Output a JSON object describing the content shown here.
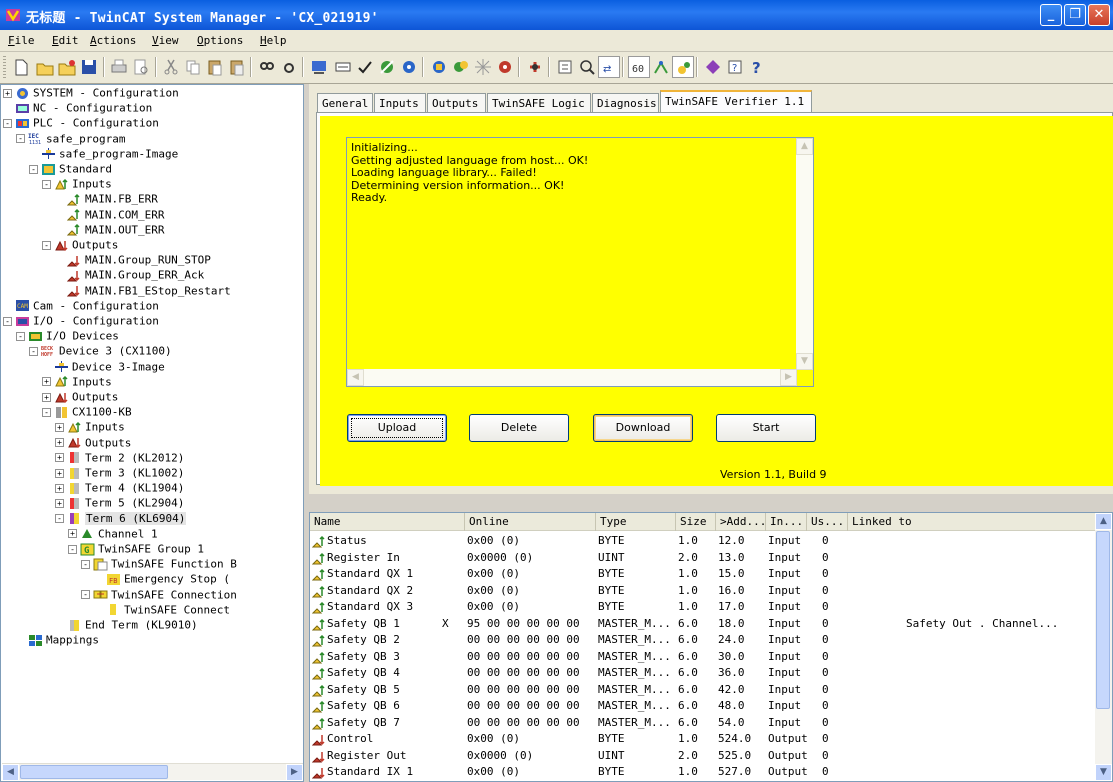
{
  "window": {
    "title": "无标题 - TwinCAT System Manager - 'CX_021919'"
  },
  "menu": [
    "File",
    "Edit",
    "Actions",
    "View",
    "Options",
    "Help"
  ],
  "tree": [
    {
      "label": "SYSTEM - Configuration",
      "icon": "system-icon",
      "exp": "+"
    },
    {
      "label": "NC - Configuration",
      "icon": "nc-icon",
      "exp": ""
    },
    {
      "label": "PLC - Configuration",
      "icon": "plc-icon",
      "exp": "-"
    },
    {
      "label": "safe_program",
      "icon": "iec-icon",
      "exp": "-"
    },
    {
      "label": "safe_program-Image",
      "icon": "image-icon",
      "exp": ""
    },
    {
      "label": "Standard",
      "icon": "task-icon",
      "exp": "-"
    },
    {
      "label": "Inputs",
      "icon": "inputs-icon",
      "exp": "-"
    },
    {
      "label": "MAIN.FB_ERR",
      "icon": "input-var-icon",
      "exp": ""
    },
    {
      "label": "MAIN.COM_ERR",
      "icon": "input-var-icon",
      "exp": ""
    },
    {
      "label": "MAIN.OUT_ERR",
      "icon": "input-var-icon",
      "exp": ""
    },
    {
      "label": "Outputs",
      "icon": "outputs-icon",
      "exp": "-"
    },
    {
      "label": "MAIN.Group_RUN_STOP",
      "icon": "output-var-icon",
      "exp": ""
    },
    {
      "label": "MAIN.Group_ERR_Ack",
      "icon": "output-var-icon",
      "exp": ""
    },
    {
      "label": "MAIN.FB1_EStop_Restart",
      "icon": "output-var-icon",
      "exp": ""
    },
    {
      "label": "Cam - Configuration",
      "icon": "cam-icon",
      "exp": ""
    },
    {
      "label": "I/O - Configuration",
      "icon": "io-icon",
      "exp": "-"
    },
    {
      "label": "I/O Devices",
      "icon": "io-devices-icon",
      "exp": "-"
    },
    {
      "label": "Device 3 (CX1100)",
      "icon": "beckhoff-icon",
      "exp": "-"
    },
    {
      "label": "Device 3-Image",
      "icon": "image-icon",
      "exp": ""
    },
    {
      "label": "Inputs",
      "icon": "inputs-icon",
      "exp": "+"
    },
    {
      "label": "Outputs",
      "icon": "outputs-icon",
      "exp": "+"
    },
    {
      "label": "CX1100-KB",
      "icon": "coupler-icon",
      "exp": "-"
    },
    {
      "label": "Inputs",
      "icon": "inputs-icon",
      "exp": "+"
    },
    {
      "label": "Outputs",
      "icon": "outputs-icon",
      "exp": "+"
    },
    {
      "label": "Term 2 (KL2012)",
      "icon": "terminal-red-icon",
      "exp": "+"
    },
    {
      "label": "Term 3 (KL1002)",
      "icon": "terminal-yellow-icon",
      "exp": "+"
    },
    {
      "label": "Term 4 (KL1904)",
      "icon": "terminal-yellow-icon",
      "exp": "+"
    },
    {
      "label": "Term 5 (KL2904)",
      "icon": "terminal-red-icon",
      "exp": "+"
    },
    {
      "label": "Term 6 (KL6904)",
      "icon": "terminal-purple-icon",
      "exp": "-"
    },
    {
      "label": "Channel 1",
      "icon": "channel-icon",
      "exp": "+"
    },
    {
      "label": "TwinSAFE Group 1",
      "icon": "group-icon",
      "exp": "-"
    },
    {
      "label": "TwinSAFE Function B",
      "icon": "function-block-icon",
      "exp": "-"
    },
    {
      "label": "Emergency Stop (",
      "icon": "estop-icon",
      "exp": ""
    },
    {
      "label": "TwinSAFE Connection",
      "icon": "connection-icon",
      "exp": "-"
    },
    {
      "label": "TwinSAFE Connect",
      "icon": "connect-icon",
      "exp": ""
    },
    {
      "label": "End Term (KL9010)",
      "icon": "end-term-icon",
      "exp": ""
    },
    {
      "label": "Mappings",
      "icon": "mappings-icon",
      "exp": ""
    }
  ],
  "tabs": [
    "General",
    "Inputs",
    "Outputs",
    "TwinSAFE Logic",
    "Diagnosis",
    "TwinSAFE Verifier 1.1"
  ],
  "verifier": {
    "log": "Initializing...\nGetting adjusted language from host... OK!\nLoading language library... Failed!\nDetermining version information... OK!\nReady.",
    "buttons": {
      "upload": "Upload",
      "delete": "Delete",
      "download": "Download",
      "start": "Start"
    },
    "version": "Version 1.1, Build 9"
  },
  "grid": {
    "columns": [
      "Name",
      "Online",
      "Type",
      "Size",
      ">Add...",
      "In...",
      "Us...",
      "Linked to"
    ],
    "rows": [
      {
        "name": "Status",
        "flag": "",
        "online": "0x00 (0)",
        "type": "BYTE",
        "size": "1.0",
        "addr": "12.0",
        "io": "Input",
        "us": "0",
        "linked": "",
        "icon": "input-var-icon"
      },
      {
        "name": "Register In",
        "flag": "",
        "online": "0x0000 (0)",
        "type": "UINT",
        "size": "2.0",
        "addr": "13.0",
        "io": "Input",
        "us": "0",
        "linked": "",
        "icon": "input-var-icon"
      },
      {
        "name": "Standard QX 1",
        "flag": "",
        "online": "0x00 (0)",
        "type": "BYTE",
        "size": "1.0",
        "addr": "15.0",
        "io": "Input",
        "us": "0",
        "linked": "",
        "icon": "input-var-icon"
      },
      {
        "name": "Standard QX 2",
        "flag": "",
        "online": "0x00 (0)",
        "type": "BYTE",
        "size": "1.0",
        "addr": "16.0",
        "io": "Input",
        "us": "0",
        "linked": "",
        "icon": "input-var-icon"
      },
      {
        "name": "Standard QX 3",
        "flag": "",
        "online": "0x00 (0)",
        "type": "BYTE",
        "size": "1.0",
        "addr": "17.0",
        "io": "Input",
        "us": "0",
        "linked": "",
        "icon": "input-var-icon"
      },
      {
        "name": "Safety QB 1",
        "flag": "X",
        "online": "95 00 00 00 00 00",
        "type": "MASTER_M...",
        "size": "6.0",
        "addr": "18.0",
        "io": "Input",
        "us": "0",
        "linked": "Safety Out . Channel...",
        "icon": "input-var-icon"
      },
      {
        "name": "Safety QB 2",
        "flag": "",
        "online": "00 00 00 00 00 00",
        "type": "MASTER_M...",
        "size": "6.0",
        "addr": "24.0",
        "io": "Input",
        "us": "0",
        "linked": "",
        "icon": "input-var-icon"
      },
      {
        "name": "Safety QB 3",
        "flag": "",
        "online": "00 00 00 00 00 00",
        "type": "MASTER_M...",
        "size": "6.0",
        "addr": "30.0",
        "io": "Input",
        "us": "0",
        "linked": "",
        "icon": "input-var-icon"
      },
      {
        "name": "Safety QB 4",
        "flag": "",
        "online": "00 00 00 00 00 00",
        "type": "MASTER_M...",
        "size": "6.0",
        "addr": "36.0",
        "io": "Input",
        "us": "0",
        "linked": "",
        "icon": "input-var-icon"
      },
      {
        "name": "Safety QB 5",
        "flag": "",
        "online": "00 00 00 00 00 00",
        "type": "MASTER_M...",
        "size": "6.0",
        "addr": "42.0",
        "io": "Input",
        "us": "0",
        "linked": "",
        "icon": "input-var-icon"
      },
      {
        "name": "Safety QB 6",
        "flag": "",
        "online": "00 00 00 00 00 00",
        "type": "MASTER_M...",
        "size": "6.0",
        "addr": "48.0",
        "io": "Input",
        "us": "0",
        "linked": "",
        "icon": "input-var-icon"
      },
      {
        "name": "Safety QB 7",
        "flag": "",
        "online": "00 00 00 00 00 00",
        "type": "MASTER_M...",
        "size": "6.0",
        "addr": "54.0",
        "io": "Input",
        "us": "0",
        "linked": "",
        "icon": "input-var-icon"
      },
      {
        "name": "Control",
        "flag": "",
        "online": "0x00 (0)",
        "type": "BYTE",
        "size": "1.0",
        "addr": "524.0",
        "io": "Output",
        "us": "0",
        "linked": "",
        "icon": "output-var-icon"
      },
      {
        "name": "Register Out",
        "flag": "",
        "online": "0x0000 (0)",
        "type": "UINT",
        "size": "2.0",
        "addr": "525.0",
        "io": "Output",
        "us": "0",
        "linked": "",
        "icon": "output-var-icon"
      },
      {
        "name": "Standard IX 1",
        "flag": "",
        "online": "0x00 (0)",
        "type": "BYTE",
        "size": "1.0",
        "addr": "527.0",
        "io": "Output",
        "us": "0",
        "linked": "",
        "icon": "output-var-icon"
      }
    ]
  },
  "colors": {
    "panel_bg": "#ffff00",
    "titlebar": "#0a5fe0",
    "tab_highlight": "#f0b43a"
  }
}
